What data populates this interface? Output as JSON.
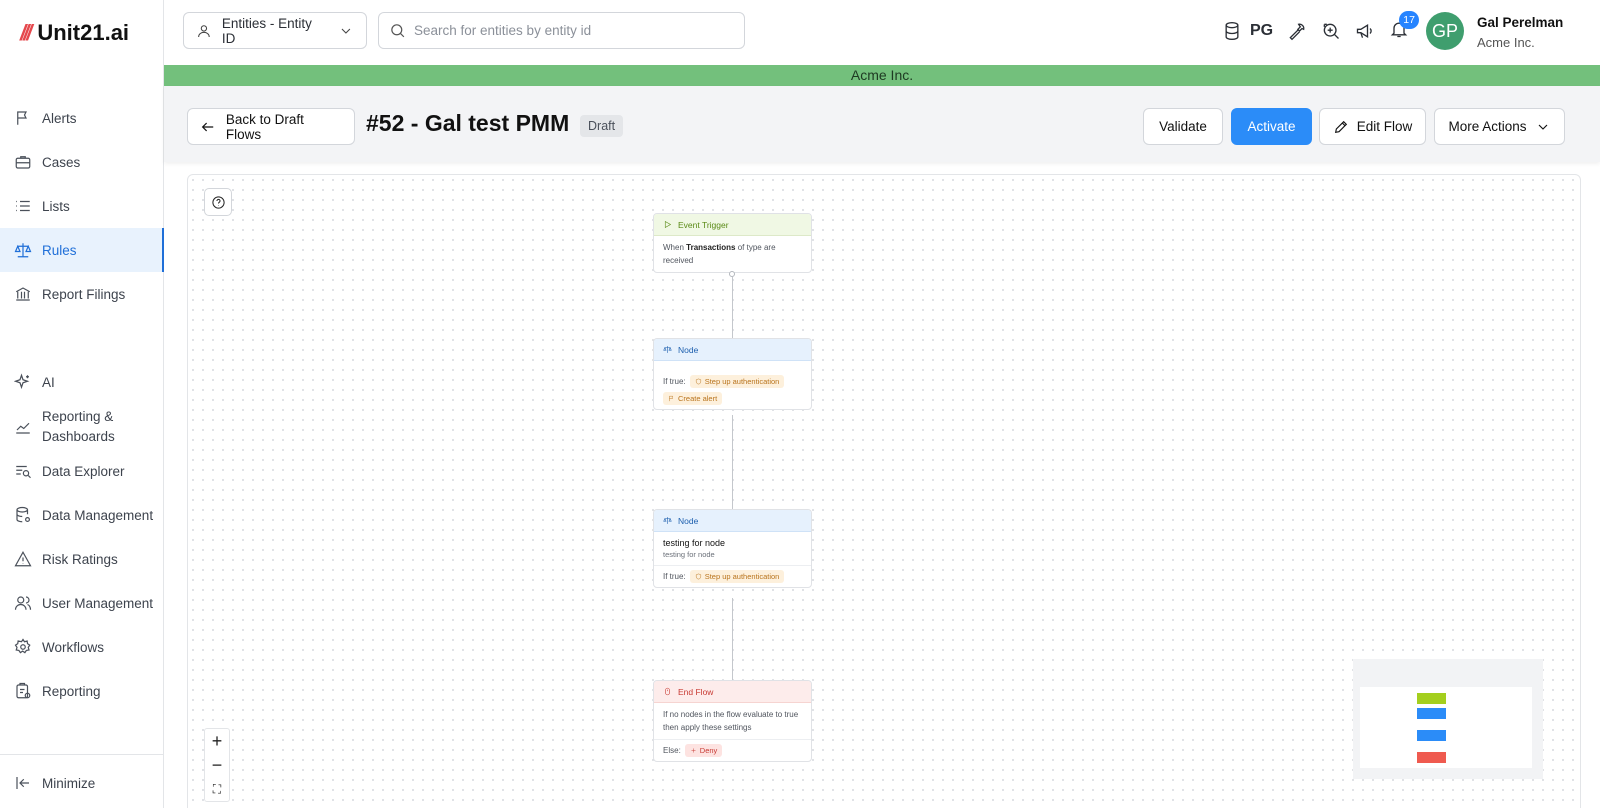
{
  "app": {
    "logo_text": "Unit21.ai",
    "logo_mark": "///"
  },
  "sidebar": {
    "items": [
      {
        "label": "Alerts",
        "icon": "flag-icon"
      },
      {
        "label": "Cases",
        "icon": "briefcase-icon"
      },
      {
        "label": "Lists",
        "icon": "list-icon"
      },
      {
        "label": "Rules",
        "icon": "scale-icon",
        "active": true
      },
      {
        "label": "Report Filings",
        "icon": "bank-icon"
      },
      {
        "label": "AI",
        "icon": "sparkle-icon"
      },
      {
        "label": "Reporting & Dashboards",
        "icon": "chart-line-icon"
      },
      {
        "label": "Data Explorer",
        "icon": "data-search-icon"
      },
      {
        "label": "Data Management",
        "icon": "database-settings-icon"
      },
      {
        "label": "Risk Ratings",
        "icon": "warning-icon"
      },
      {
        "label": "User Management",
        "icon": "users-icon"
      },
      {
        "label": "Workflows",
        "icon": "gear-icon"
      },
      {
        "label": "Reporting",
        "icon": "clipboard-icon"
      }
    ],
    "minimize_label": "Minimize"
  },
  "topbar": {
    "entity_select": "Entities - Entity ID",
    "search_placeholder": "Search for entities by entity id",
    "db_label": "PG",
    "notification_count": "17",
    "avatar_initials": "GP",
    "user_name": "Gal Perelman",
    "user_org": "Acme Inc."
  },
  "org_banner": "Acme Inc.",
  "header": {
    "back_label": "Back to Draft Flows",
    "title": "#52 - Gal test PMM",
    "status": "Draft",
    "validate_label": "Validate",
    "activate_label": "Activate",
    "edit_label": "Edit Flow",
    "more_label": "More Actions"
  },
  "flow": {
    "trigger": {
      "title": "Event Trigger",
      "text_prefix": "When",
      "text_bold": "Transactions",
      "text_suffix": "of type are received"
    },
    "node1": {
      "title": "Node",
      "if_true_label": "If true:",
      "action1": "Step up authentication",
      "action2": "Create alert"
    },
    "node2": {
      "title": "Node",
      "name": "testing for node",
      "description": "testing for node",
      "if_true_label": "If true:",
      "action1": "Step up authentication"
    },
    "end": {
      "title": "End Flow",
      "text": "If no nodes in the flow evaluate to true then apply these settings",
      "else_label": "Else:",
      "else_action": "Deny"
    }
  },
  "zoom": {
    "in": "+",
    "out": "−",
    "fit": "⛶"
  },
  "colors": {
    "accent": "#2b8cf8",
    "banner": "#73c07c",
    "trigger": "#a4cf1e",
    "node": "#2b8cf8",
    "end": "#ef5a4f"
  }
}
